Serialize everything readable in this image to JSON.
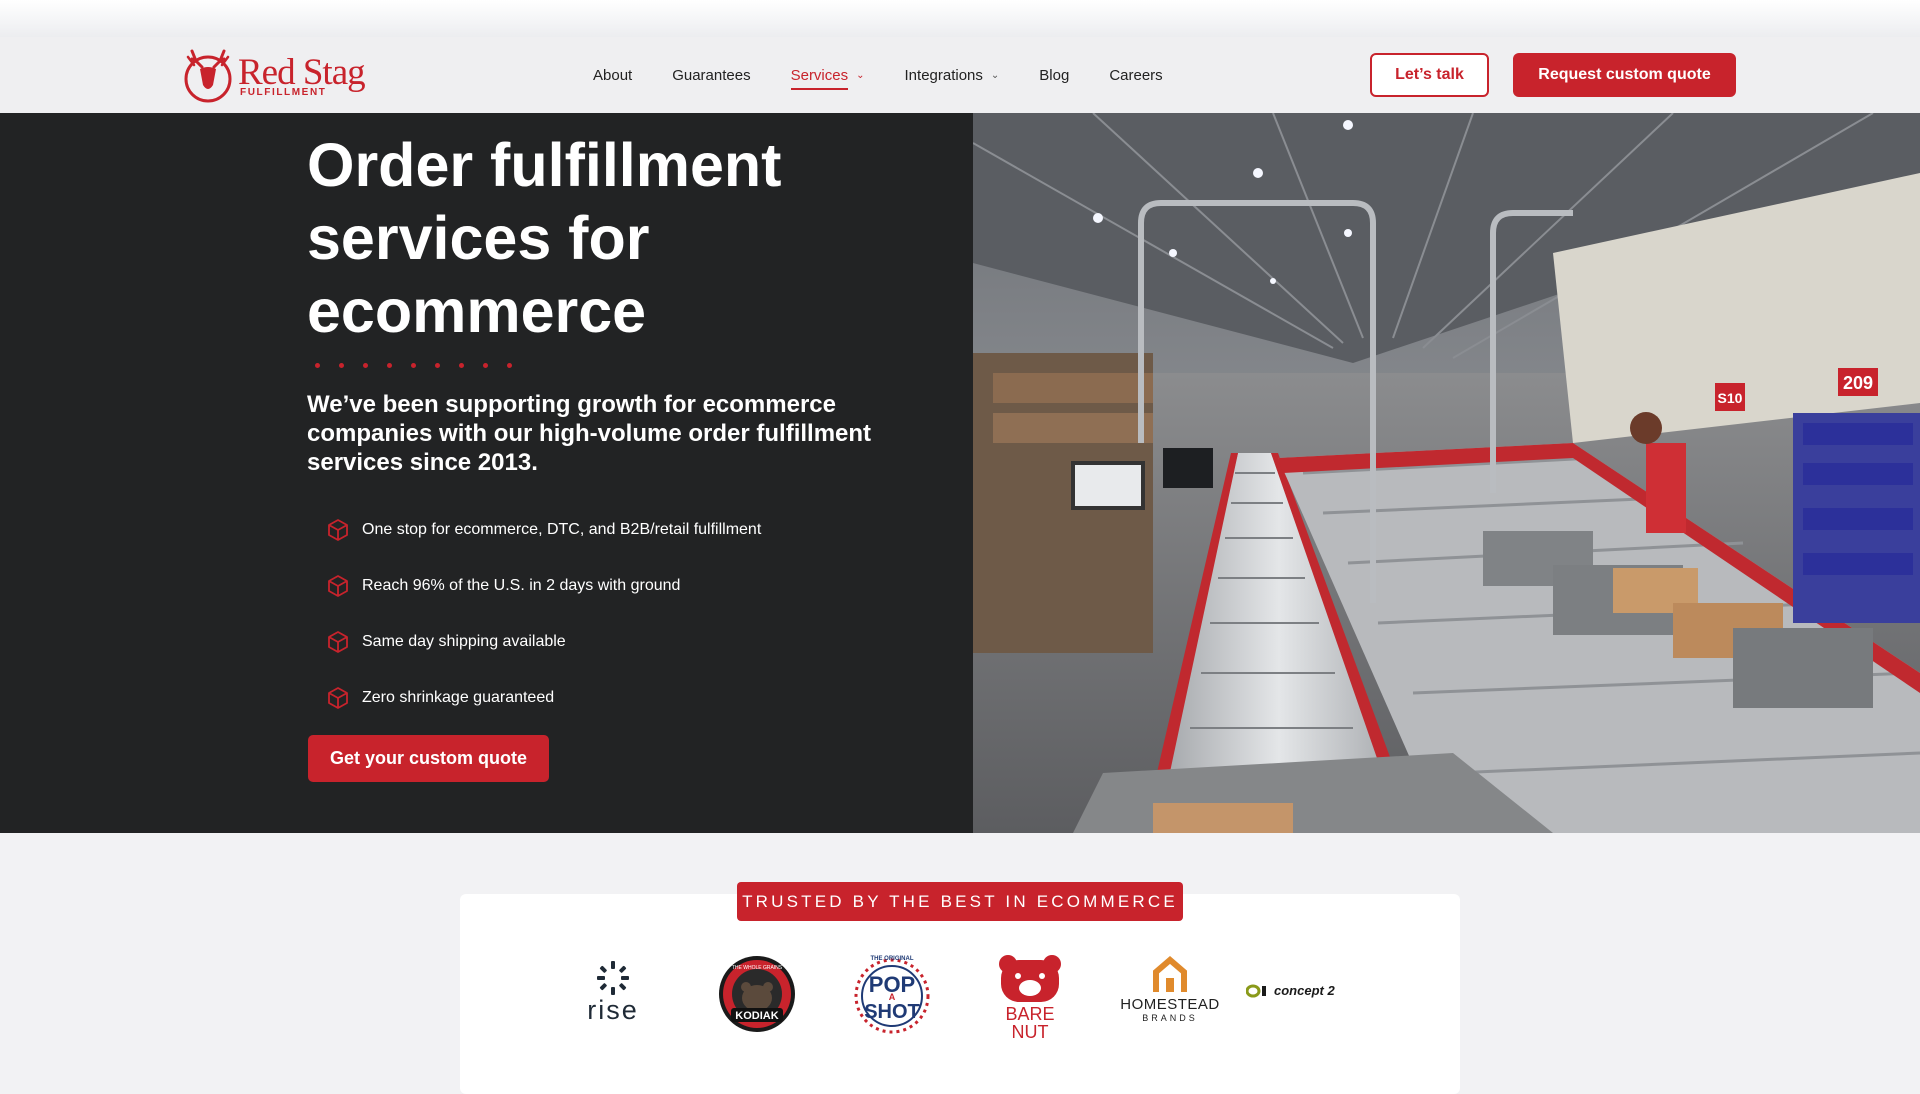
{
  "brand": {
    "name": "Red Stag",
    "tagline": "FULFILLMENT",
    "color": "#c8232c"
  },
  "nav": {
    "items": [
      {
        "label": "About",
        "has_dropdown": false,
        "active": false
      },
      {
        "label": "Guarantees",
        "has_dropdown": false,
        "active": false
      },
      {
        "label": "Services",
        "has_dropdown": true,
        "active": true
      },
      {
        "label": "Integrations",
        "has_dropdown": true,
        "active": false
      },
      {
        "label": "Blog",
        "has_dropdown": false,
        "active": false
      },
      {
        "label": "Careers",
        "has_dropdown": false,
        "active": false
      }
    ]
  },
  "header_actions": {
    "talk_label": "Let’s talk",
    "quote_label": "Request custom quote"
  },
  "hero": {
    "title": "Order fulfillment services for ecommerce",
    "subtitle": "We’ve been supporting growth for ecommerce companies with our high-volume order fulfillment services since 2013.",
    "bullets": [
      "One stop for ecommerce, DTC, and B2B/retail fulfillment",
      "Reach 96% of the U.S. in 2 days with ground",
      "Same day shipping available",
      "Zero shrinkage guaranteed"
    ],
    "cta_label": "Get your custom quote",
    "photo_signs": [
      "209",
      "S10"
    ]
  },
  "trusted": {
    "heading": "TRUSTED BY THE BEST IN ECOMMERCE",
    "logos": {
      "rise": "rise",
      "kodiak": "KODIAK",
      "kodiak_arc": "THE WHOLE GRAINS",
      "popshot_arc": "THE ORIGINAL",
      "popshot_top": "POP",
      "popshot_mid": "A",
      "popshot_bottom": "SHOT",
      "barenut_1": "BARE",
      "barenut_2": "NUT",
      "homestead_1": "HOMESTEAD",
      "homestead_2": "BRANDS",
      "concept2": "concept 2"
    }
  }
}
